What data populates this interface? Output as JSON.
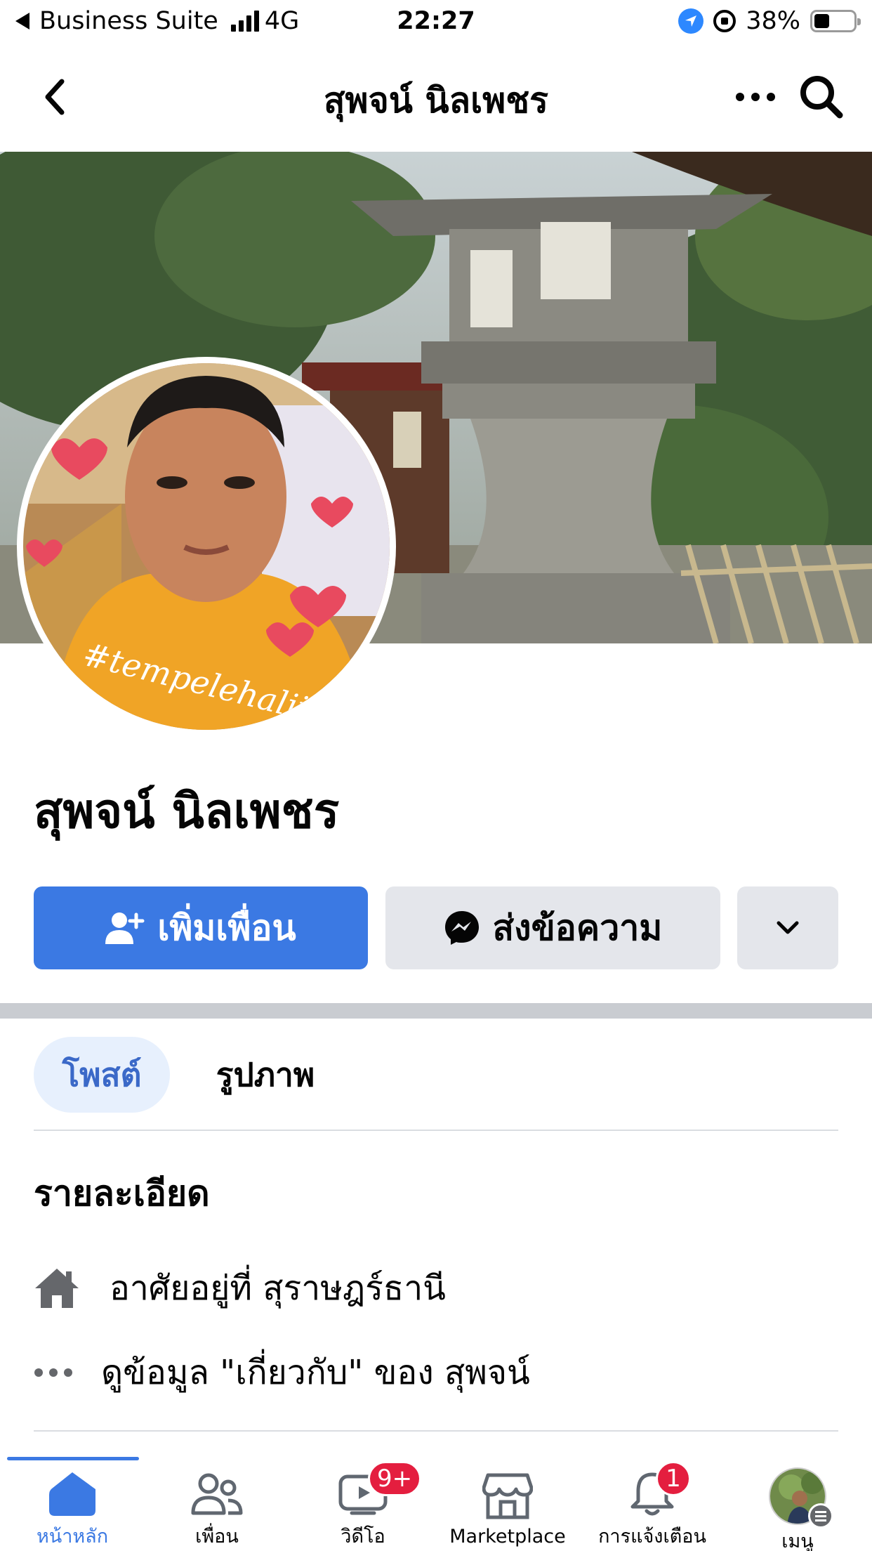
{
  "status_bar": {
    "back_app": "Business Suite",
    "network": "4G",
    "time": "22:27",
    "battery": "38%",
    "battery_level": 0.38
  },
  "nav": {
    "title": "สุพจน์ นิลเพชร",
    "back_icon": "chevron-left-icon",
    "more_icon": "more-horizontal-icon",
    "search_icon": "search-icon"
  },
  "profile": {
    "name": "สุพจน์ นิลเพชร",
    "avatar_caption": "#tempelehalii",
    "add_friend_label": "เพิ่มเพื่อน",
    "message_label": "ส่งข้อความ"
  },
  "tabs": {
    "posts": "โพสต์",
    "photos": "รูปภาพ"
  },
  "details": {
    "title": "รายละเอียด",
    "lives_in": "อาศัยอยู่ที่ สุราษฎร์ธานี",
    "see_about": "ดูข้อมูล \"เกี่ยวกับ\" ของ สุพจน์"
  },
  "bottom_tabs": [
    {
      "label": "หน้าหลัก",
      "icon": "home-icon",
      "active": true
    },
    {
      "label": "เพื่อน",
      "icon": "friends-icon"
    },
    {
      "label": "วิดีโอ",
      "icon": "video-icon",
      "badge": "9+"
    },
    {
      "label": "Marketplace",
      "icon": "marketplace-icon"
    },
    {
      "label": "การแจ้งเตือน",
      "icon": "bell-icon",
      "badge": "1"
    },
    {
      "label": "เมนู",
      "icon": "menu-avatar-icon"
    }
  ],
  "colors": {
    "accent": "#3b79e3",
    "button_gray": "#e4e6eb",
    "badge": "#e41e3f",
    "tab_active_bg": "#e7f0fd"
  }
}
